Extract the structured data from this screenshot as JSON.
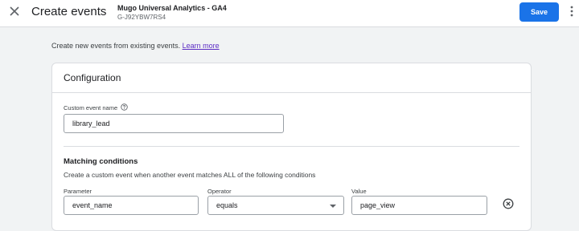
{
  "header": {
    "title": "Create events",
    "property_name": "Mugo Universal Analytics - GA4",
    "property_id": "G-J92YBW7RS4",
    "save_label": "Save"
  },
  "intro": {
    "text": "Create new events from existing events.",
    "link_label": "Learn more"
  },
  "configuration": {
    "title": "Configuration",
    "custom_event_name": {
      "label": "Custom event name",
      "value": "library_lead"
    },
    "matching_conditions": {
      "title": "Matching conditions",
      "description": "Create a custom event when another event matches ALL of the following conditions",
      "conditions": [
        {
          "parameter_label": "Parameter",
          "parameter_value": "event_name",
          "operator_label": "Operator",
          "operator_value": "equals",
          "value_label": "Value",
          "value_value": "page_view"
        }
      ]
    }
  },
  "icons": {
    "close": "close-icon",
    "more": "more-vert-icon",
    "help": "help-icon",
    "dropdown": "arrow-drop-down-icon",
    "remove": "remove-circle-icon"
  },
  "colors": {
    "primary": "#1a73e8",
    "link": "#5b2bc4",
    "background": "#f1f3f4",
    "card": "#ffffff",
    "border": "#dadce0"
  }
}
